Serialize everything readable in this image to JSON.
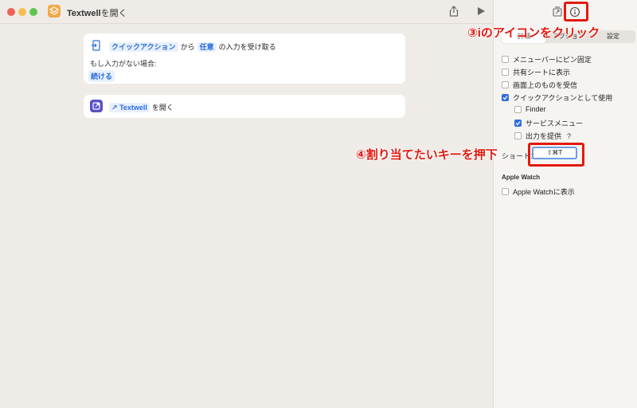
{
  "window": {
    "title_app": "Textwell",
    "title_suffix": "を開く"
  },
  "workflow": {
    "card1": {
      "token_input_type": "クイックアクション",
      "from_text": "から",
      "token_any": "任意",
      "receive_text": "の入力を受け取る",
      "if_none_text": "もし入力がない場合:",
      "token_continue": "続ける"
    },
    "card2": {
      "app_token_glyph": "↗",
      "app_token_name": "Textwell",
      "open_text": "を開く"
    }
  },
  "sidebar": {
    "segments": [
      "詳細",
      "アクション",
      "設定"
    ],
    "options": {
      "menubar": "メニューバーにピン固定",
      "share_sheet": "共有シートに表示",
      "receive_screen": "画面上のものを受信",
      "quick_action": "クイックアクションとして使用",
      "finder": "Finder",
      "services": "サービスメニュー",
      "provide_output": "出力を提供"
    },
    "help_mark": "?",
    "keyboard_label": "ショートカット",
    "keyboard_value": "⇧⌘T",
    "apple_watch_title": "Apple Watch",
    "apple_watch_option": "Apple Watchに表示"
  },
  "annotations": {
    "step3": "③iのアイコンをクリック",
    "step4": "④割り当てたいキーを押下"
  },
  "colors": {
    "accent": "#2d6cdf",
    "highlight": "#e3190f"
  }
}
